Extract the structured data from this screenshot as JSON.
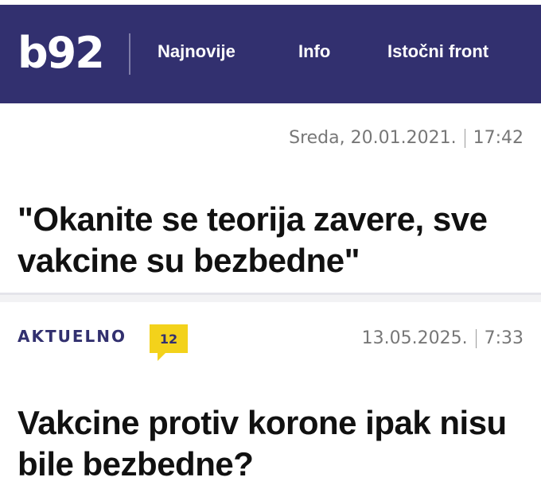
{
  "header": {
    "logo_text": "b92",
    "nav": [
      "Najnovije",
      "Info",
      "Istočni front"
    ],
    "colors": {
      "bar": "#32306f",
      "text": "#ffffff"
    }
  },
  "article1": {
    "day": "Sreda,",
    "date": "20.01.2021.",
    "time": "17:42",
    "headline": "\"Okanite se teorija zavere, sve vakcine su bezbedne\""
  },
  "article2": {
    "category": "AKTUELNO",
    "comments": "12",
    "date": "13.05.2025.",
    "time": "7:33",
    "headline": "Vakcine protiv korone ipak nisu bile bezbedne?"
  },
  "accent_colors": {
    "badge": "#f3d21b",
    "category": "#32306f"
  }
}
